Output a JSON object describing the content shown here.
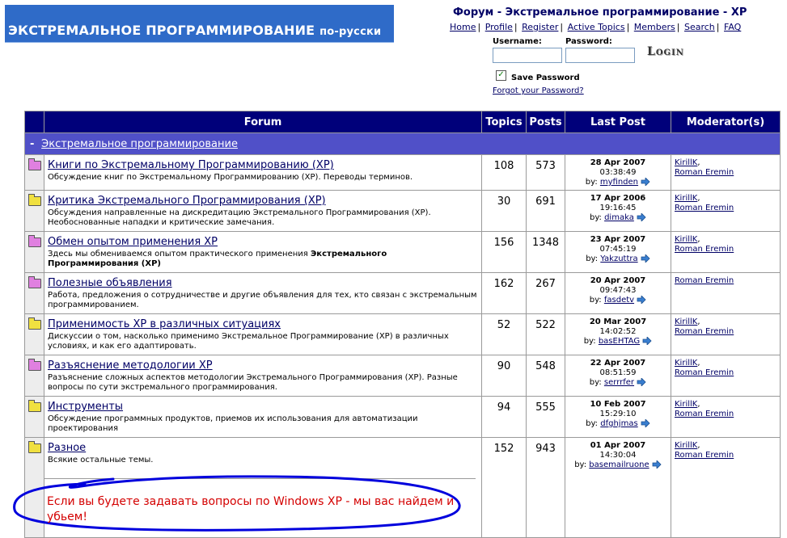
{
  "banner": {
    "main": "ЭКСТРЕМАЛЬНОЕ ПРОГРАММИРОВАНИЕ",
    "sub": "по-русски"
  },
  "header": {
    "title": "Форум - Экстремальное программирование - XP"
  },
  "nav": [
    "Home",
    "Profile",
    "Register",
    "Active Topics",
    "Members",
    "Search",
    "FAQ"
  ],
  "login": {
    "username_label": "Username:",
    "password_label": "Password:",
    "button_label": "Login",
    "save_password": "Save Password",
    "forgot": "Forgot your Password?"
  },
  "table": {
    "headers": {
      "forum": "Forum",
      "topics": "Topics",
      "posts": "Posts",
      "last_post": "Last Post",
      "moderators": "Moderator(s)"
    },
    "category": {
      "toggle": "-",
      "name": "Экстремальное программирование"
    },
    "by_label": "by:",
    "rows": [
      {
        "name": "Книги по Экстремальному Программированию (XP)",
        "desc": "Обсуждение книг по Экстремальному Программированию (XP). Переводы терминов.",
        "desc_bold": "",
        "topics": "108",
        "posts": "573",
        "date": "28 Apr 2007",
        "time": "03:38:49",
        "by": "myfinden",
        "mods": [
          "KirillK",
          "Roman Eremin"
        ]
      },
      {
        "name": "Критика Экстремального Программирования (XP)",
        "desc": "Обсуждения направленные на дискредитацию Экстремального Программирования (XP). Необоснованные нападки и критические замечания.",
        "desc_bold": "",
        "topics": "30",
        "posts": "691",
        "date": "17 Apr 2006",
        "time": "19:16:45",
        "by": "dimaka",
        "mods": [
          "KirillK",
          "Roman Eremin"
        ]
      },
      {
        "name": "Обмен опытом применения XP",
        "desc": "Здесь мы обмениваемся опытом практического применения ",
        "desc_bold": "Экстремального Программирования (XP)",
        "topics": "156",
        "posts": "1348",
        "date": "23 Apr 2007",
        "time": "07:45:19",
        "by": "Yakzuttra",
        "mods": [
          "KirillK",
          "Roman Eremin"
        ]
      },
      {
        "name": "Полезные объявления",
        "desc": "Работа, предложения о сотрудничестве и другие объявления для тех, кто связан с экстремальным программированием.",
        "desc_bold": "",
        "topics": "162",
        "posts": "267",
        "date": "20 Apr 2007",
        "time": "09:47:43",
        "by": "fasdetv",
        "mods": [
          "Roman Eremin"
        ]
      },
      {
        "name": "Применимость XP в различных ситуациях",
        "desc": "Дискуссии о том, насколько применимо Экстремальное Программирование (XP) в различных условиях, и как его адаптировать.",
        "desc_bold": "",
        "topics": "52",
        "posts": "522",
        "date": "20 Mar 2007",
        "time": "14:02:52",
        "by": "basEHTAG",
        "mods": [
          "KirillK",
          "Roman Eremin"
        ]
      },
      {
        "name": "Разъяснение методологии XP",
        "desc": "Разъяснение сложных аспектов методологии Экстремального Программирования (XP). Разные вопросы по сути экстремального программирования.",
        "desc_bold": "",
        "topics": "90",
        "posts": "548",
        "date": "22 Apr 2007",
        "time": "08:51:59",
        "by": "serrrfer",
        "mods": [
          "KirillK",
          "Roman Eremin"
        ]
      },
      {
        "name": "Инструменты",
        "desc": "Обсуждение программных продуктов, приемов их использования для автоматизации проектирования",
        "desc_bold": "",
        "topics": "94",
        "posts": "555",
        "date": "10 Feb 2007",
        "time": "15:29:10",
        "by": "dfghjmas",
        "mods": [
          "KirillK",
          "Roman Eremin"
        ]
      },
      {
        "name": "Разное",
        "desc": "Всякие остальные темы.",
        "desc_bold": "",
        "topics": "152",
        "posts": "943",
        "date": "01 Apr 2007",
        "time": "14:30:04",
        "by": "basemailruone",
        "mods": [
          "KirillK",
          "Roman Eremin"
        ]
      }
    ]
  },
  "warning": "Если вы будете задавать вопросы по Windows XP - мы вас найдем и убьем!",
  "colors": {
    "header_bg": "#00007a",
    "category_bg": "#5050c8",
    "banner_bg": "#2f6bc8",
    "warning_text": "#d40000",
    "scribble": "#0000dd"
  }
}
